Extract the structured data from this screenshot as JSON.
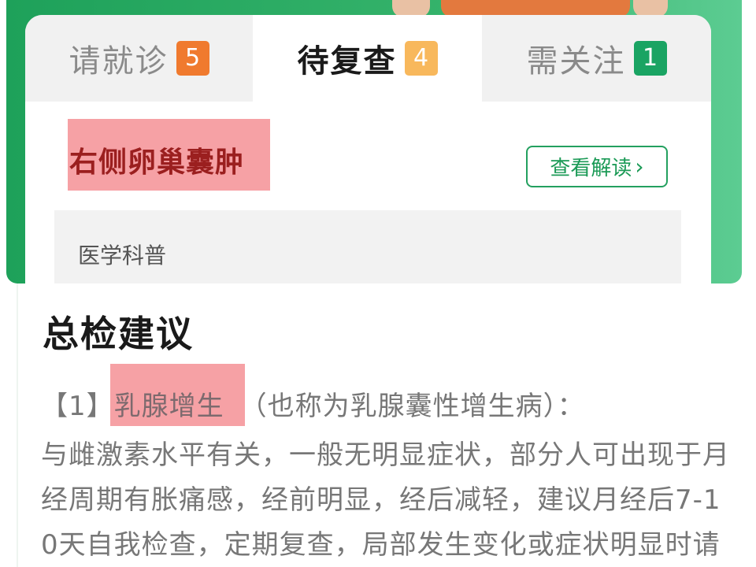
{
  "tabs": [
    {
      "label": "请就诊",
      "count": "5",
      "color": "#f07a2e"
    },
    {
      "label": "待复查",
      "count": "4",
      "color": "#f8b85c"
    },
    {
      "label": "需关注",
      "count": "1",
      "color": "#1aa463"
    }
  ],
  "condition": {
    "title": "右侧卵巢囊肿",
    "view_button": "查看解读"
  },
  "science": {
    "label": "医学科普"
  },
  "suggestion": {
    "section_title": "总检建议",
    "item_index": "【1】",
    "item_keyword": "乳腺增生",
    "item_alias": "（也称为乳腺囊性增生病）：",
    "lines": [
      "与雌激素水平有关，一般无明显症状，部分人可出现于月",
      "经周期有胀痛感，经前明显，经后减轻，建议月经后7-1",
      "0天自我检查，定期复查，局部发生变化或症状明显时请"
    ]
  },
  "colors": {
    "brand_green": "#1ea15a",
    "highlight": "#f6a1a5",
    "condition_text": "#9b1f1f"
  }
}
